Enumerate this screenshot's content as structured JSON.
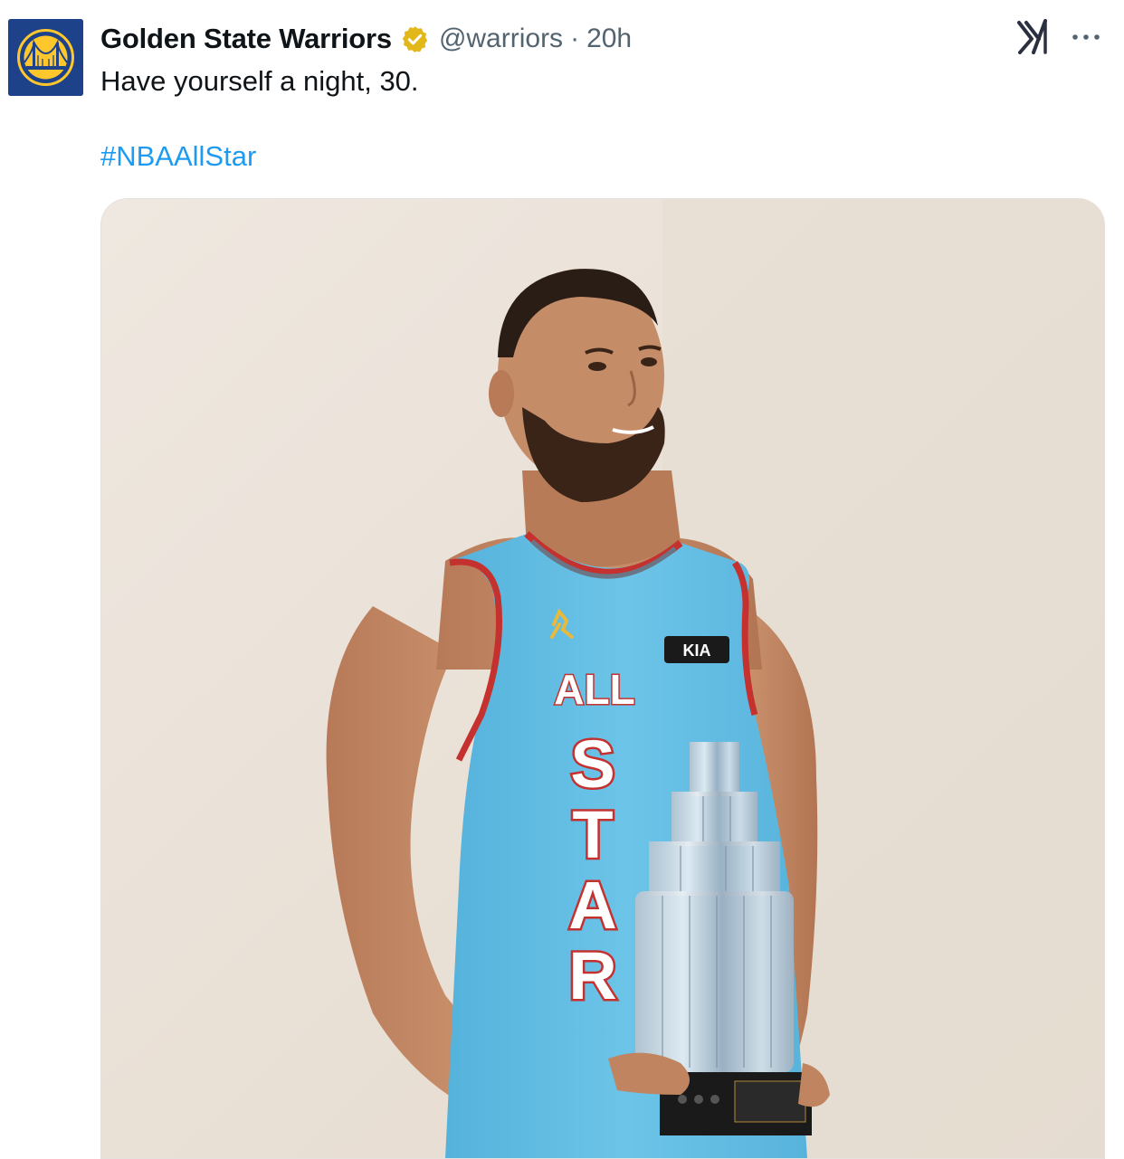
{
  "tweet": {
    "display_name": "Golden State Warriors",
    "handle": "@warriors",
    "separator": "·",
    "time": "20h",
    "text": "Have yourself a night, 30.",
    "hashtag": "#NBAAllStar",
    "verified": true
  },
  "icons": {
    "avatar": "warriors-logo",
    "verified": "verified-badge-icon",
    "platform": "x-logo-icon",
    "more": "more-options-icon"
  },
  "media": {
    "type": "photo",
    "jersey_text": [
      "ALL",
      "STAR"
    ],
    "sponsor": "KIA"
  },
  "colors": {
    "accent_link": "#1d9bf0",
    "secondary_text": "#536471",
    "avatar_bg": "#1d428a",
    "avatar_gold": "#ffc72c",
    "verified_gold": "#e2b719"
  }
}
